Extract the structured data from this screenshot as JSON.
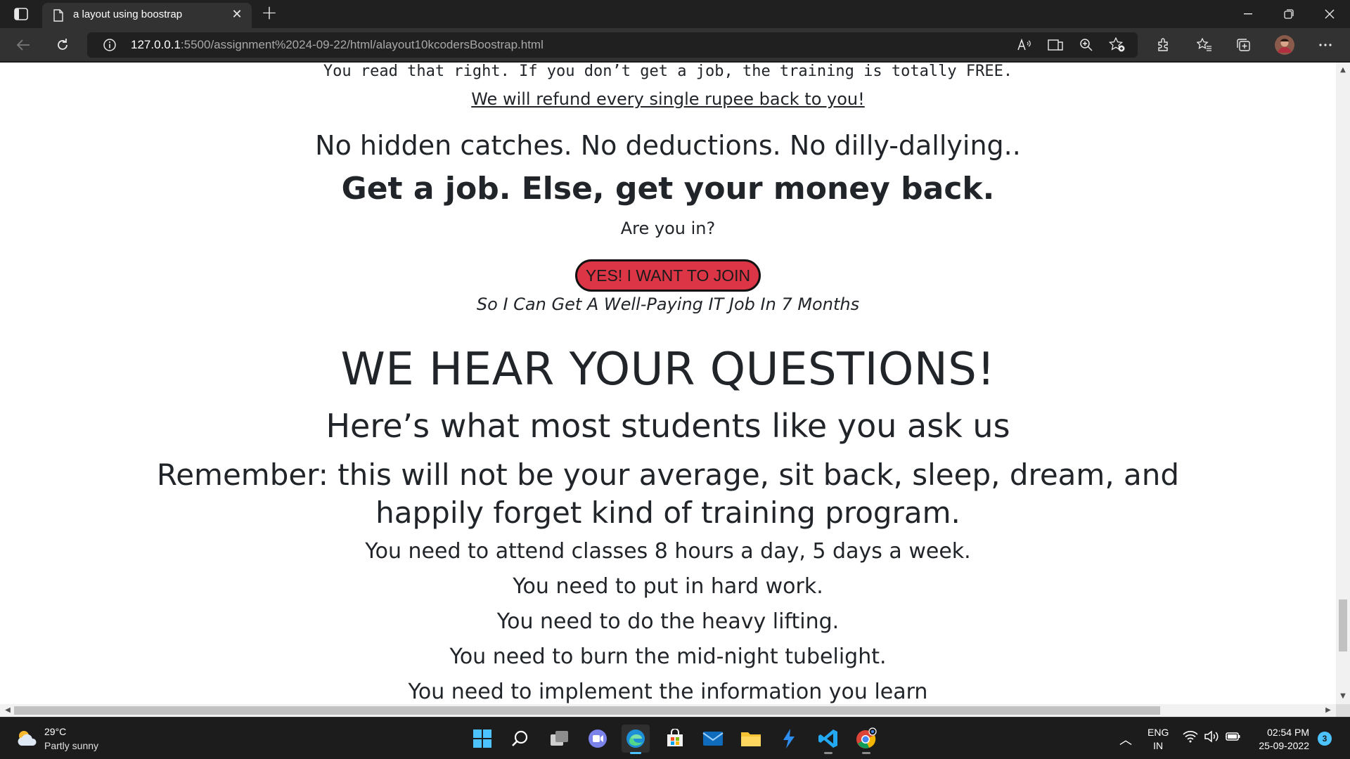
{
  "browser": {
    "tab_title": "a layout using boostrap",
    "url_host": "127.0.0.1",
    "url_rest": ":5500/assignment%2024-09-22/html/alayout10kcodersBoostrap.html"
  },
  "page": {
    "mono_line": "You read that right. If you don’t get a job, the training is totally FREE.",
    "refund_link": "We will refund every single rupee back to you!",
    "no_catches": "No hidden catches. No deductions. No dilly-dallying..",
    "get_job": "Get a job. Else, get your money back.",
    "are_you_in": "Are you in?",
    "join_button": "YES! I WANT TO JOIN",
    "so_i_can": "So I Can Get A Well-Paying IT Job In 7 Months",
    "questions_title": "WE HEAR YOUR QUESTIONS!",
    "questions_subtitle": "Here’s what most students like you ask us",
    "remember": "Remember: this will not be your average, sit back, sleep, dream, and happily forget kind of training program.",
    "needs": [
      "You need to attend classes 8 hours a day, 5 days a week.",
      "You need to put in hard work.",
      "You need to do the heavy lifting.",
      "You need to burn the mid-night tubelight.",
      "You need to implement the information you learn"
    ],
    "join_button_color": "#dc3545"
  },
  "taskbar": {
    "temperature": "29°C",
    "weather": "Partly sunny",
    "lang_1": "ENG",
    "lang_2": "IN",
    "time": "02:54 PM",
    "date": "25-09-2022",
    "notification_count": "3"
  }
}
